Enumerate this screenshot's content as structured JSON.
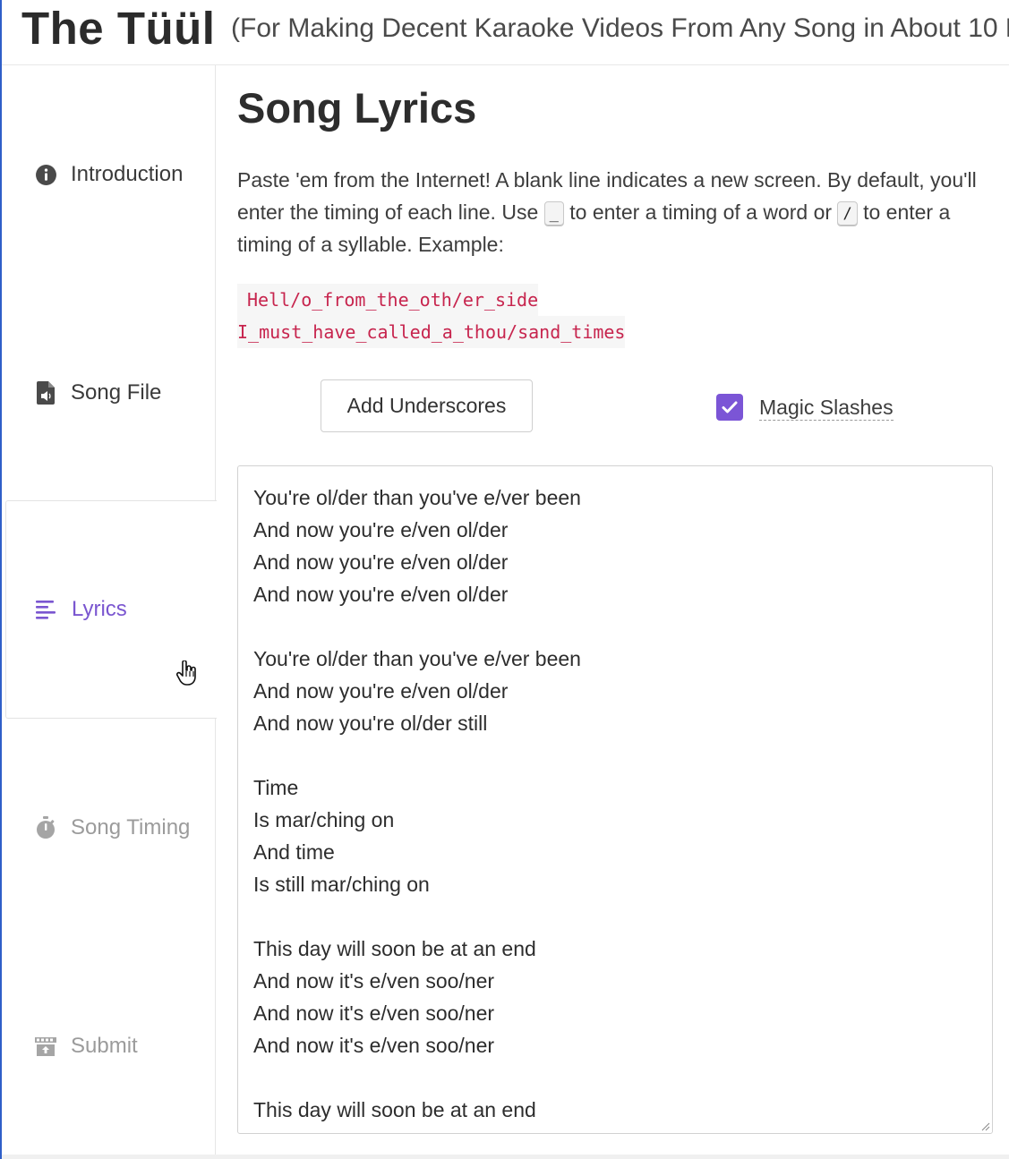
{
  "app": {
    "title": "The Tüül",
    "subtitle": "(For Making Decent Karaoke Videos From Any Song in About 10 M"
  },
  "sidebar": {
    "items": [
      {
        "label": "Introduction",
        "icon": "info-circle-icon",
        "state": "normal"
      },
      {
        "label": "Song File",
        "icon": "audio-file-icon",
        "state": "normal"
      },
      {
        "label": "Lyrics",
        "icon": "align-left-icon",
        "state": "active"
      },
      {
        "label": "Song Timing",
        "icon": "stopwatch-icon",
        "state": "disabled"
      },
      {
        "label": "Submit",
        "icon": "film-upload-icon",
        "state": "disabled"
      }
    ]
  },
  "main": {
    "title": "Song Lyrics",
    "intro": {
      "part1": "Paste 'em from the Internet! A blank line indicates a new screen. By default, you'll enter the timing of each line. Use ",
      "key1": "_",
      "part2": " to enter a timing of a word or ",
      "key2": "/",
      "part3": " to enter a timing of a syllable. Example:"
    },
    "example_lines": [
      "Hell/o_from_the_oth/er_side",
      "I_must_have_called_a_thou/sand_times"
    ],
    "add_underscores_label": "Add Underscores",
    "magic_slashes": {
      "label": "Magic Slashes",
      "checked": true
    },
    "lyrics_value": "You're ol/der than you've e/ver been\nAnd now you're e/ven ol/der\nAnd now you're e/ven ol/der\nAnd now you're e/ven ol/der\n\nYou're ol/der than you've e/ver been\nAnd now you're e/ven ol/der\nAnd now you're ol/der still\n\nTime\nIs mar/ching on\nAnd time\nIs still mar/ching on\n\nThis day will soon be at an end\nAnd now it's e/ven soo/ner\nAnd now it's e/ven soo/ner\nAnd now it's e/ven soo/ner\n\nThis day will soon be at an end"
  },
  "colors": {
    "accent": "#7b55d6",
    "code": "#c7254e",
    "left_edge": "#2f5fc8"
  }
}
